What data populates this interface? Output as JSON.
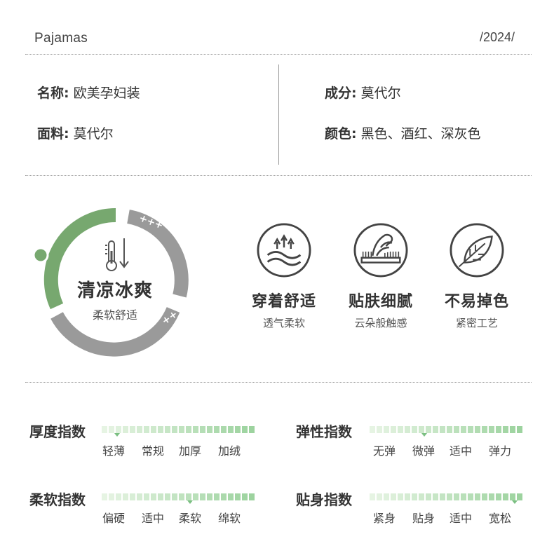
{
  "header": {
    "brand": "Pajamas",
    "year": "/2024/"
  },
  "specs": {
    "name_label": "名称:",
    "name_value": "欧美孕妇装",
    "fabric_label": "面料:",
    "fabric_value": "莫代尔",
    "composition_label": "成分:",
    "composition_value": "莫代尔",
    "color_label": "颜色:",
    "color_value": "黑色、酒红、深灰色"
  },
  "ring": {
    "title": "清凉冰爽",
    "subtitle": "柔软舒适",
    "mark_top": "+++",
    "mark_bottom": "++",
    "colors": {
      "green": "#77a86f",
      "gray": "#9a9a9a"
    }
  },
  "features": [
    {
      "icon": "air-wave-icon",
      "title": "穿着舒适",
      "subtitle": "透气柔软"
    },
    {
      "icon": "hand-touch-icon",
      "title": "贴肤细腻",
      "subtitle": "云朵般触感"
    },
    {
      "icon": "leaf-icon",
      "title": "不易掉色",
      "subtitle": "紧密工艺"
    }
  ],
  "indices": [
    {
      "title": "厚度指数",
      "levels": [
        "轻薄",
        "常规",
        "加厚",
        "加绒"
      ],
      "selected": 0,
      "position": 0.1
    },
    {
      "title": "弹性指数",
      "levels": [
        "无弹",
        "微弹",
        "适中",
        "弹力"
      ],
      "selected": 1,
      "position": 0.36
    },
    {
      "title": "柔软指数",
      "levels": [
        "偏硬",
        "适中",
        "柔软",
        "绵软"
      ],
      "selected": 2,
      "position": 0.58
    },
    {
      "title": "贴身指数",
      "levels": [
        "紧身",
        "贴身",
        "适中",
        "宽松"
      ],
      "selected": 3,
      "position": 0.95
    }
  ],
  "colors": {
    "bar_light": "#e6f4e3",
    "bar_dark": "#9dd39f",
    "marker": "#7bbf82"
  }
}
